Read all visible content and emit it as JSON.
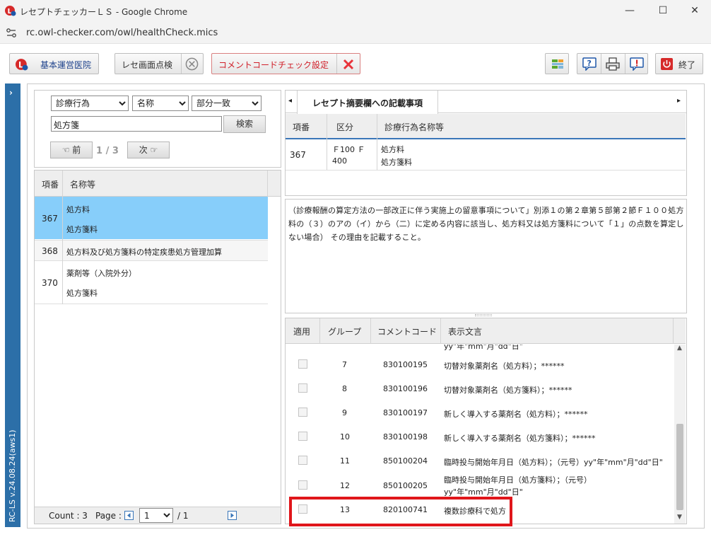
{
  "window": {
    "title": "レセプトチェッカーＬＳ - Google Chrome",
    "url": "rc.owl-checker.com/owl/healthCheck.mics"
  },
  "toolbar": {
    "hospital_label": "基本運営医院",
    "screen_check_label": "レセ画面点検",
    "comment_code_label": "コメントコードチェック設定",
    "exit_label": "終了"
  },
  "side": {
    "version": "RC-LS v.24.08.24(aws1)"
  },
  "search": {
    "select1": "診療行為",
    "select2": "名称",
    "select3": "部分一致",
    "query": "処方箋",
    "search_label": "検索",
    "prev_label": "☜ 前",
    "next_label": "次 ☞",
    "page_indicator": "1 / 3"
  },
  "result_table": {
    "col_no": "項番",
    "col_name": "名称等",
    "rows": [
      {
        "no": "367",
        "line1": "処方料",
        "line2": "処方箋料"
      },
      {
        "no": "368",
        "line1": "処方料及び処方箋料の特定疾患処方管理加算",
        "line2": ""
      },
      {
        "no": "370",
        "line1": "薬剤等（入院外分）",
        "line2": "処方箋料"
      }
    ]
  },
  "pager": {
    "count": "Count : 3",
    "page_label": "Page :",
    "page_value": "1",
    "total": "/ 1"
  },
  "detail": {
    "tab_label": "レセプト摘要欄への記載事項",
    "col_no": "項番",
    "col_kubun": "区分",
    "col_name": "診療行為名称等",
    "row": {
      "no": "367",
      "kubun1": "Ｆ100 Ｆ",
      "kubun2": "400",
      "name1": "処方料",
      "name2": "処方箋料"
    },
    "description": "（診療報酬の算定方法の一部改正に伴う実施上の留意事項について」別添１の第２章第５部第２節Ｆ１００処方料の（３）のアの（イ）から（二）に定める内容に該当し、処方料又は処方箋料について「１」の点数を算定しない場合） その理由を記載すること。"
  },
  "comments": {
    "col_apply": "適用",
    "col_group": "グループ",
    "col_code": "コメントコード",
    "col_text": "表示文言",
    "partial_top": "yy\"年\"mm\"月\"dd\"日\"",
    "rows": [
      {
        "group": "7",
        "code": "830100195",
        "text1": "切替対象薬剤名（処方料）；******",
        "text2": ""
      },
      {
        "group": "8",
        "code": "830100196",
        "text1": "切替対象薬剤名（処方箋料）；******",
        "text2": ""
      },
      {
        "group": "9",
        "code": "830100197",
        "text1": "新しく導入する薬剤名（処方料）；******",
        "text2": ""
      },
      {
        "group": "10",
        "code": "830100198",
        "text1": "新しく導入する薬剤名（処方箋料）；******",
        "text2": ""
      },
      {
        "group": "11",
        "code": "850100204",
        "text1": "臨時投与開始年月日（処方料）；（元号）yy\"年\"mm\"月\"dd\"日\"",
        "text2": ""
      },
      {
        "group": "12",
        "code": "850100205",
        "text1": "臨時投与開始年月日（処方箋料）；（元号）",
        "text2": "yy\"年\"mm\"月\"dd\"日\""
      },
      {
        "group": "13",
        "code": "820100741",
        "text1": "複数診療科で処方",
        "text2": ""
      }
    ]
  },
  "colors": {
    "accent_blue": "#2c6fa8",
    "selected_row": "#87cefa",
    "highlight_red": "#e0161b"
  }
}
